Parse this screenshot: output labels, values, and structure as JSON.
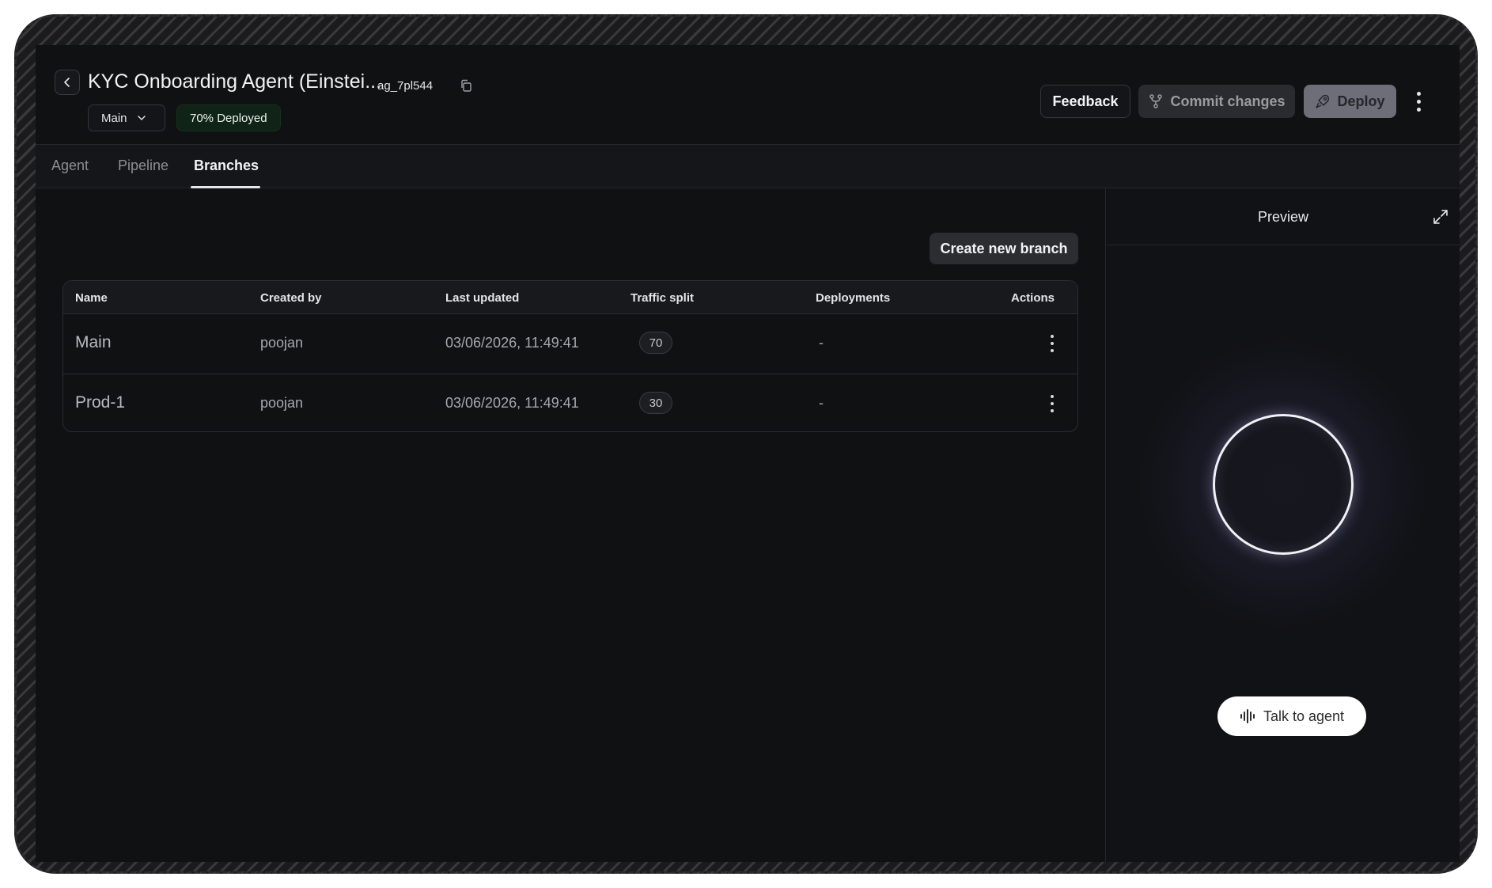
{
  "header": {
    "title": "KYC Onboarding Agent (Einstei...",
    "agent_id": "ag_7pl544",
    "branch_select": "Main",
    "deploy_badge": "70% Deployed",
    "feedback_label": "Feedback",
    "commit_label": "Commit changes",
    "deploy_label": "Deploy"
  },
  "tabs": [
    {
      "label": "Agent",
      "active": false
    },
    {
      "label": "Pipeline",
      "active": false
    },
    {
      "label": "Branches",
      "active": true
    }
  ],
  "branches": {
    "create_label": "Create new branch",
    "columns": [
      "Name",
      "Created by",
      "Last updated",
      "Traffic split",
      "Deployments",
      "Actions"
    ],
    "rows": [
      {
        "name": "Main",
        "created_by": "poojan",
        "last_updated": "03/06/2026, 11:49:41",
        "traffic_split": "70",
        "deployments": "-"
      },
      {
        "name": "Prod-1",
        "created_by": "poojan",
        "last_updated": "03/06/2026, 11:49:41",
        "traffic_split": "30",
        "deployments": "-"
      }
    ]
  },
  "preview": {
    "title": "Preview",
    "talk_label": "Talk to agent"
  },
  "icons": {
    "back": "chevron-left-icon",
    "copy": "copy-icon",
    "dropdown": "chevron-down-icon",
    "commit": "git-branch-icon",
    "deploy": "rocket-icon",
    "more": "more-vertical-icon",
    "expand": "expand-icon",
    "voice": "audio-wave-icon"
  },
  "colors": {
    "background": "#101113",
    "deploy_badge_bg": "#0f2316",
    "deploy_button_bg": "#6e6e78",
    "talk_button_bg": "#ffffff"
  }
}
